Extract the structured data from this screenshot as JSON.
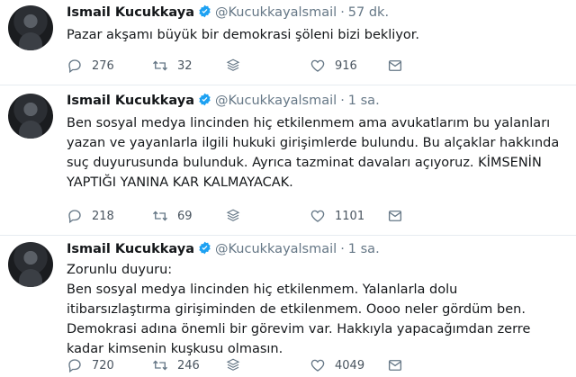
{
  "tweets": [
    {
      "name": "Ismail Kucukkaya",
      "handle": "@Kucukkayalsmail",
      "separator": "·",
      "time": "57 dk.",
      "text": "Pazar akşamı büyük bir demokrasi şöleni bizi bekliyor.",
      "replies": "276",
      "retweets": "32",
      "likes": "916"
    },
    {
      "name": "Ismail Kucukkaya",
      "handle": "@Kucukkayalsmail",
      "separator": "·",
      "time": "1 sa.",
      "text": "Ben sosyal medya lincinden hiç etkilenmem ama avukatlarım bu yalanları yazan ve yayanlarla ilgili hukuki girişimlerde bulundu. Bu alçaklar hakkında suç duyurusunda bulunduk. Ayrıca tazminat davaları açıyoruz. KİMSENİN YAPTIĞI YANINA KAR KALMAYACAK.",
      "replies": "218",
      "retweets": "69",
      "likes": "1101"
    },
    {
      "name": "Ismail Kucukkaya",
      "handle": "@Kucukkayalsmail",
      "separator": "·",
      "time": "1 sa.",
      "text_lines": [
        "Zorunlu duyuru:",
        "Ben sosyal medya lincinden hiç etkilenmem. Yalanlarla dolu itibarsızlaştırma girişiminden de etkilenmem. Oooo neler gördüm ben. Demokrasi adına önemli bir görevim var. Hakkıyla yapacağımdan zerre kadar kimsenin kuşkusu olmasın."
      ],
      "replies": "720",
      "retweets": "246",
      "likes": "4049"
    }
  ],
  "colors": {
    "verified": "#1da1f2",
    "muted": "#657786",
    "text": "#14171a"
  },
  "icons": [
    "reply-icon",
    "retweet-icon",
    "stats-icon",
    "like-icon",
    "message-icon",
    "verified-icon"
  ]
}
